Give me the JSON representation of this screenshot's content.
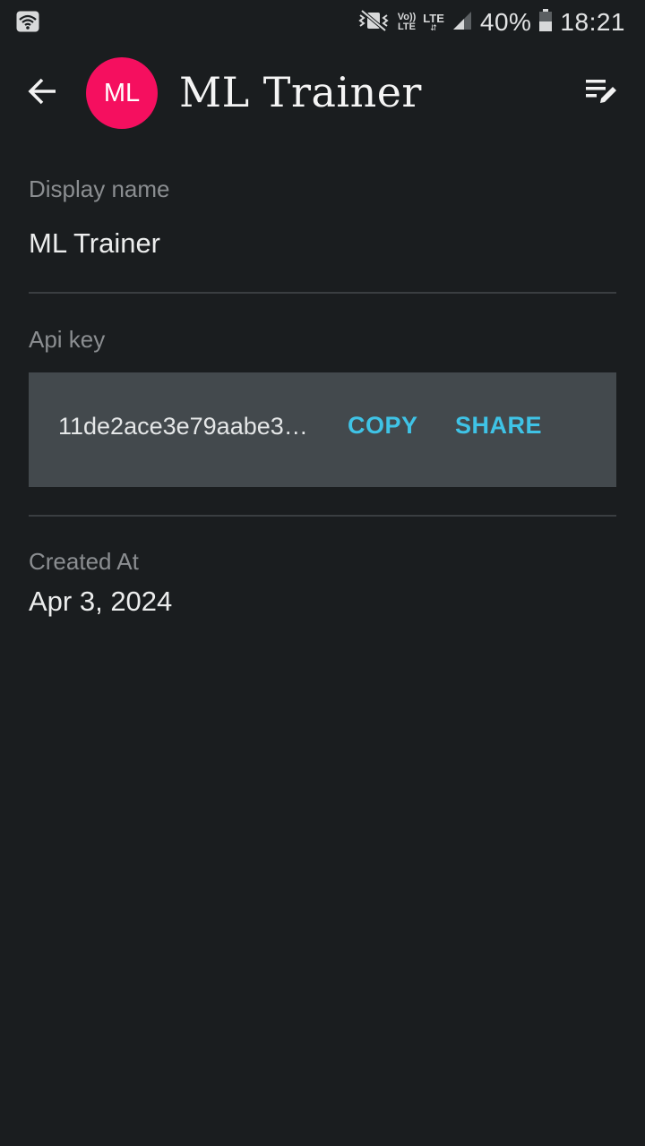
{
  "status_bar": {
    "wifi_icon": "wifi-icon",
    "mute_icon": "vibrate-mute-icon",
    "volte_top": "Vo))",
    "volte_bottom": "LTE",
    "lte_label": "LTE",
    "battery_percent": "40%",
    "time": "18:21"
  },
  "app_bar": {
    "back_icon": "arrow-back-icon",
    "avatar_initials": "ML",
    "avatar_color": "#f50f5f",
    "title": "ML Trainer",
    "edit_icon": "edit-list-icon"
  },
  "fields": {
    "display_name_label": "Display name",
    "display_name_value": "ML Trainer",
    "api_key_label": "Api key",
    "api_key_value": "11de2ace3e79aabe3…",
    "copy_label": "COPY",
    "share_label": "SHARE",
    "created_at_label": "Created At",
    "created_at_value": "Apr 3, 2024"
  },
  "colors": {
    "background": "#1a1d1f",
    "accent": "#3fc3e6",
    "key_box": "#43494d"
  }
}
